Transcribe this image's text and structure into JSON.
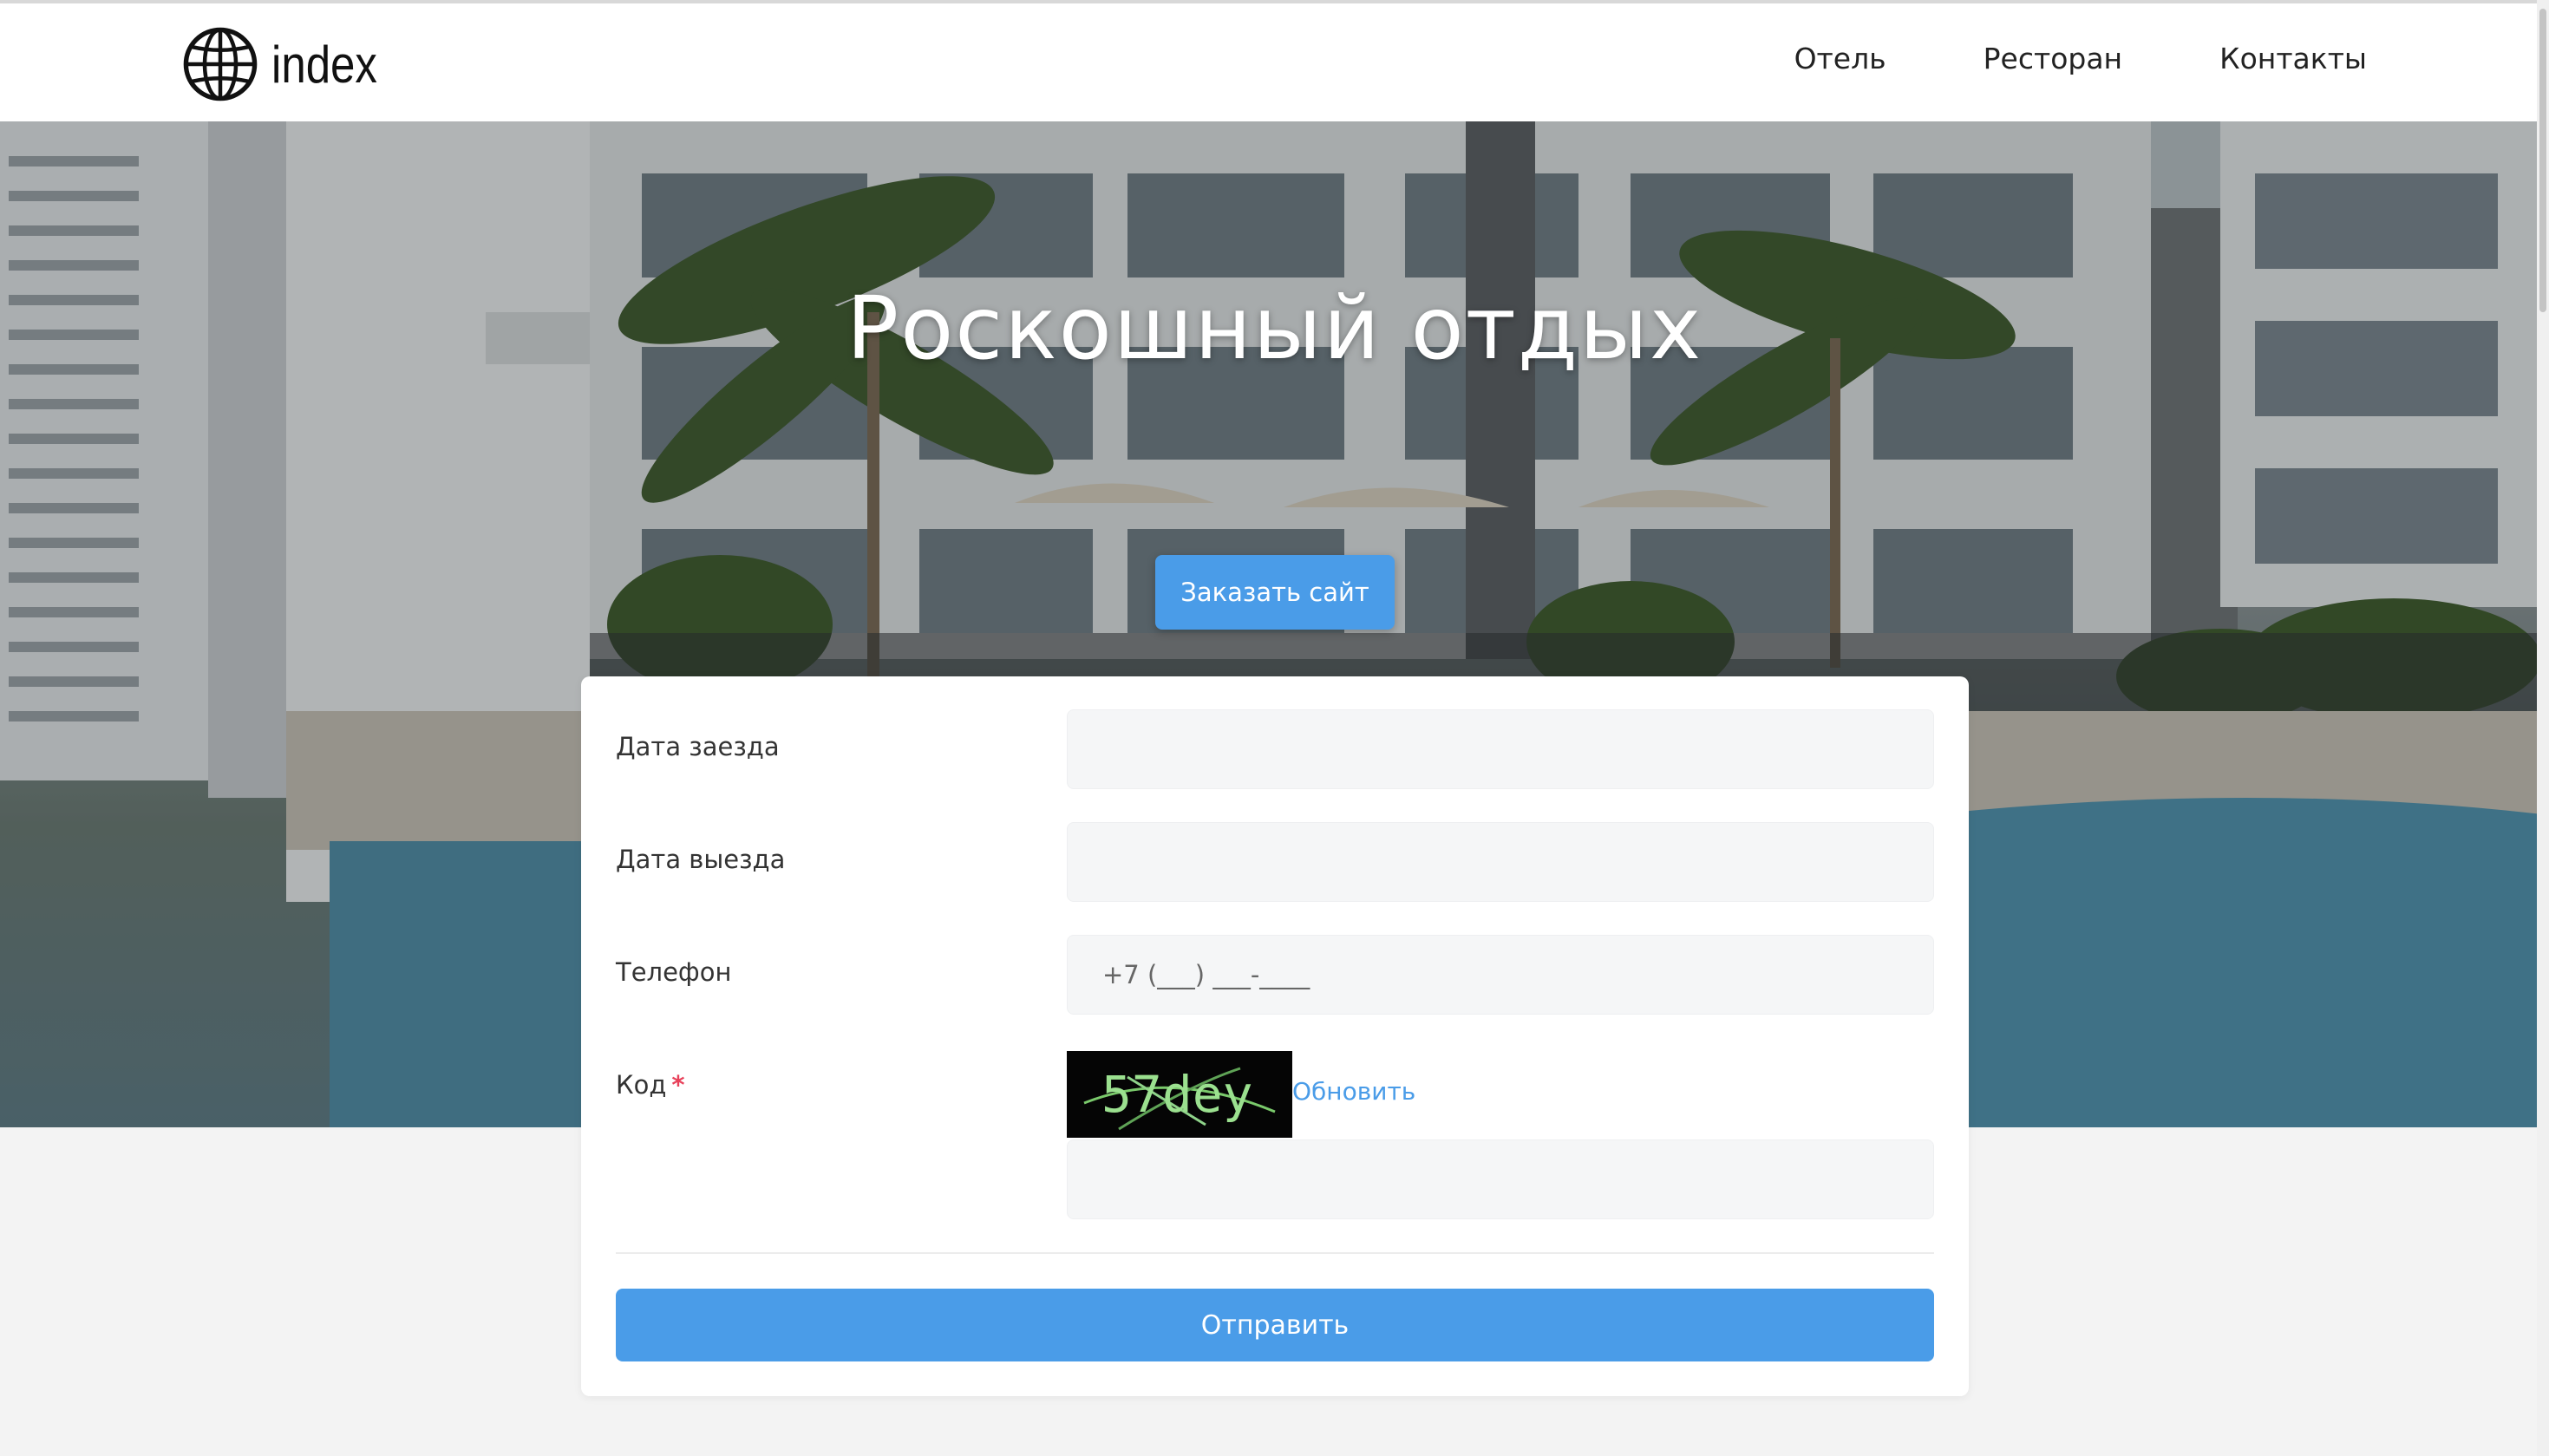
{
  "header": {
    "logo_text": "index",
    "nav": [
      "Отель",
      "Ресторан",
      "Контакты"
    ]
  },
  "hero": {
    "title": "Роскошный отдых",
    "order_button": "Заказать сайт"
  },
  "form": {
    "checkin_label": "Дата заезда",
    "checkin_value": "",
    "checkout_label": "Дата выезда",
    "checkout_value": "",
    "phone_label": "Телефон",
    "phone_value": "+7 (___) ___-____",
    "code_label": "Код",
    "code_required_mark": "*",
    "captcha_text": "57dey",
    "refresh_label": "Обновить",
    "code_value": "",
    "submit_label": "Отправить"
  },
  "colors": {
    "accent": "#4a9ce8",
    "required": "#e8415a",
    "field_bg": "#f5f6f7",
    "page_bg": "#f3f3f3"
  },
  "icons": {
    "logo": "globe-icon"
  }
}
